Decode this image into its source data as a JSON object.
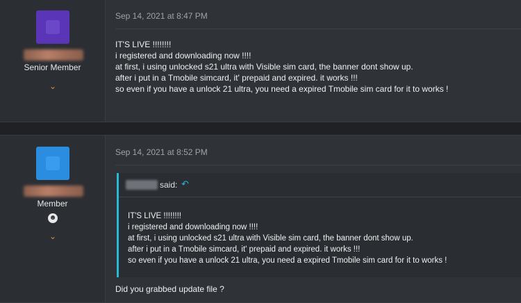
{
  "posts": [
    {
      "user_title": "Senior Member",
      "timestamp": "Sep 14, 2021 at 8:47 PM",
      "lines": [
        "IT'S LIVE !!!!!!!!",
        "i registered and downloading now !!!!",
        "at first, i using unlocked s21 ultra with Visible sim card, the banner dont show up.",
        "after i put in a Tmobile simcard, it' prepaid and expired. it works !!!",
        "so even if you have a unlock 21 ultra, you need a expired Tmobile sim card for it to works !"
      ],
      "avatar_color": "#5a35b8",
      "icons": {
        "expand": "chevron-down-icon"
      }
    },
    {
      "user_title": "Member",
      "timestamp": "Sep 14, 2021 at 8:52 PM",
      "quote": {
        "said_label": "said:",
        "lines": [
          "IT'S LIVE !!!!!!!!",
          "i registered and downloading now !!!!",
          "at first, i using unlocked s21 ultra with Visible sim card, the banner dont show up.",
          "after i put in a Tmobile simcard, it' prepaid and expired. it works !!!",
          "so even if you have a unlock 21 ultra, you need a expired Tmobile sim card for it to works !"
        ],
        "accent_color": "#29b8d6"
      },
      "reply": "Did you grabbed update file ?",
      "avatar_color": "#2a8de0",
      "icons": {
        "expand": "chevron-down-icon",
        "badge": "user-badge-icon",
        "jump": "jump-to-quote-icon"
      }
    }
  ],
  "colors": {
    "background": "#1f2124",
    "post_bg": "#2f3237",
    "chevron": "#e8893a"
  }
}
